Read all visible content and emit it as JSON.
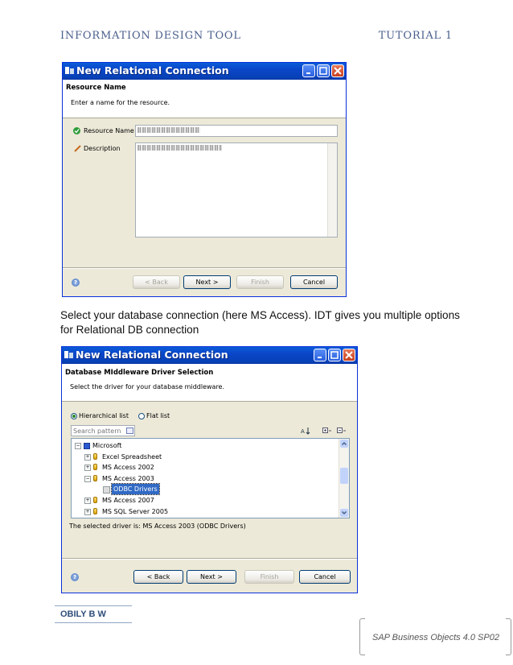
{
  "header": {
    "left": "INFORMATION DESIGN TOOL",
    "right": "TUTORIAL 1"
  },
  "dialog1": {
    "title": "New Relational Connection",
    "section_title": "Resource Name",
    "section_desc": "Enter a name for the resource.",
    "resource_name_label": "Resource Name",
    "description_label": "Description",
    "buttons": {
      "back": "< Back",
      "next": "Next >",
      "finish": "Finish",
      "cancel": "Cancel"
    }
  },
  "paragraph": "Select your database connection (here MS Access). IDT gives you multiple options for Relational DB connection",
  "dialog2": {
    "title": "New Relational Connection",
    "section_title": "Database MIddleware Driver Selection",
    "section_desc": "Select the driver for your database middleware.",
    "radio_hierarchical": "Hierarchical list",
    "radio_flat": "Flat list",
    "search_placeholder": "Search pattern",
    "tree": [
      {
        "label": "Microsoft",
        "level": 0,
        "toggle": "−"
      },
      {
        "label": "Excel Spreadsheet",
        "level": 1,
        "toggle": "+"
      },
      {
        "label": "MS Access 2002",
        "level": 1,
        "toggle": "+"
      },
      {
        "label": "MS Access 2003",
        "level": 1,
        "toggle": "−"
      },
      {
        "label": "ODBC Drivers",
        "level": 2,
        "toggle": "",
        "selected": true
      },
      {
        "label": "MS Access 2007",
        "level": 1,
        "toggle": "+"
      },
      {
        "label": "MS SQL Server 2005",
        "level": 1,
        "toggle": "+"
      }
    ],
    "selected_driver_text": "The selected driver is: MS Access 2003 (ODBC Drivers)",
    "buttons": {
      "back": "< Back",
      "next": "Next >",
      "finish": "Finish",
      "cancel": "Cancel"
    }
  },
  "footer": {
    "name": "OBILY B W",
    "product": "SAP Business Objects 4.0 SP02"
  },
  "colors": {
    "xp_blue": "#0a46c8",
    "dialog_bg": "#ece9d8",
    "selection": "#316ac5",
    "header_text": "#4a5f8c"
  }
}
